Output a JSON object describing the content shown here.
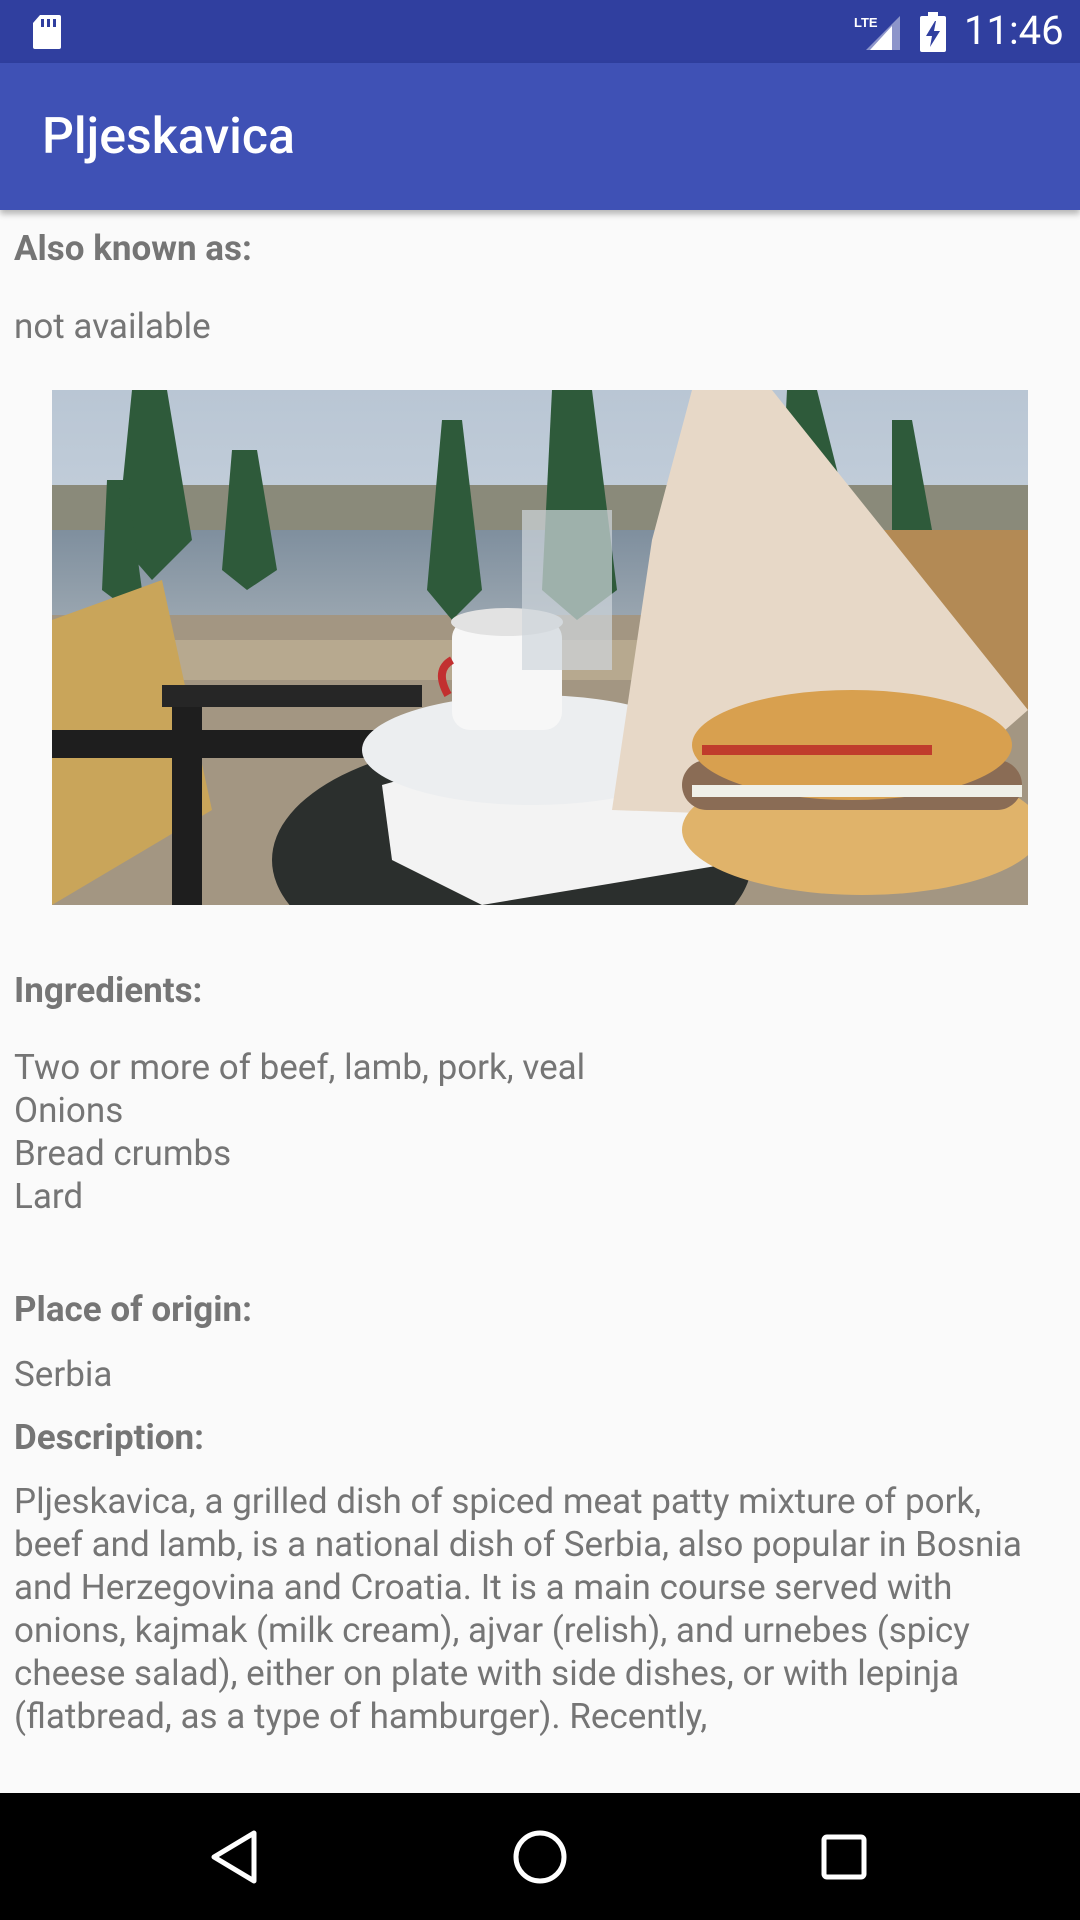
{
  "status_bar": {
    "time": "11:46",
    "network": "LTE",
    "icons": [
      "sd-card-icon",
      "lte-signal-icon",
      "battery-charging-icon"
    ]
  },
  "app_bar": {
    "title": "Pljeskavica"
  },
  "details": {
    "aka_label": "Also known as:",
    "aka_value": "not available",
    "ingredients_label": "Ingredients:",
    "ingredients": [
      "Two or more of beef, lamb, pork, veal",
      "Onions",
      "Bread crumbs",
      "Lard"
    ],
    "origin_label": "Place of origin:",
    "origin_value": "Serbia",
    "description_label": "Description:",
    "description": "Pljeskavica, a grilled dish of spiced meat patty mixture of pork, beef and lamb, is a national dish of Serbia, also popular in Bosnia and Herzegovina and Croatia. It is a main course served with onions, kajmak (milk cream), ajvar (relish), and urnebes (spicy cheese salad), either on plate with side dishes, or with lepinja (flatbread, as a type of hamburger). Recently,"
  },
  "nav_bar": {
    "icons": [
      "back-icon",
      "home-icon",
      "recents-icon"
    ]
  },
  "colors": {
    "status_bar": "#303f9f",
    "app_bar": "#3f51b5",
    "text": "#757575",
    "background": "#fafafa"
  }
}
